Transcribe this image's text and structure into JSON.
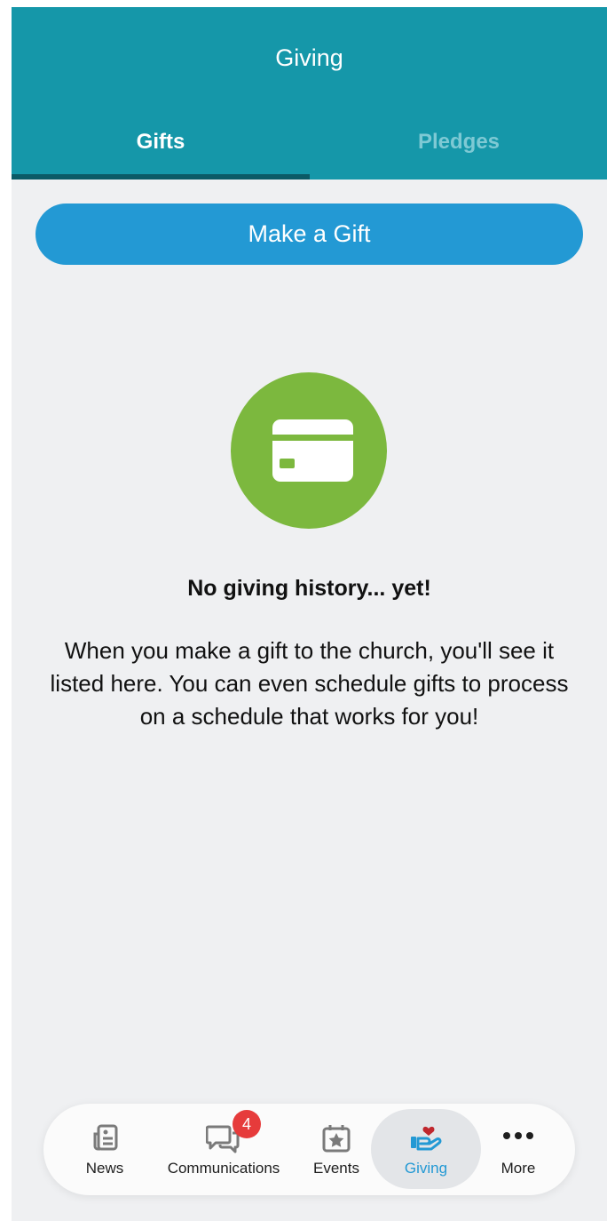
{
  "header": {
    "title": "Giving"
  },
  "tabs": [
    {
      "label": "Gifts",
      "active": true
    },
    {
      "label": "Pledges",
      "active": false
    }
  ],
  "make_gift_button": {
    "label": "Make a Gift"
  },
  "empty_state": {
    "icon": "credit-card-icon",
    "title": "No giving history... yet!",
    "body": "When you make a gift to the church, you'll see it listed here. You can even schedule gifts to process on a schedule that works for you!"
  },
  "bottom_nav": {
    "items": [
      {
        "label": "News",
        "icon": "news-icon"
      },
      {
        "label": "Communications",
        "icon": "chat-bubbles-icon",
        "badge": "4"
      },
      {
        "label": "Events",
        "icon": "calendar-star-icon"
      },
      {
        "label": "Giving",
        "icon": "hand-heart-icon",
        "active": true
      },
      {
        "label": "More",
        "icon": "more-dots-icon"
      }
    ]
  },
  "colors": {
    "header": "#1597a9",
    "tab_indicator": "#0b5a66",
    "button": "#2399d4",
    "empty_icon_bg": "#7cb83e",
    "active_tab_label": "#2399d4",
    "badge": "#e63b3b"
  }
}
